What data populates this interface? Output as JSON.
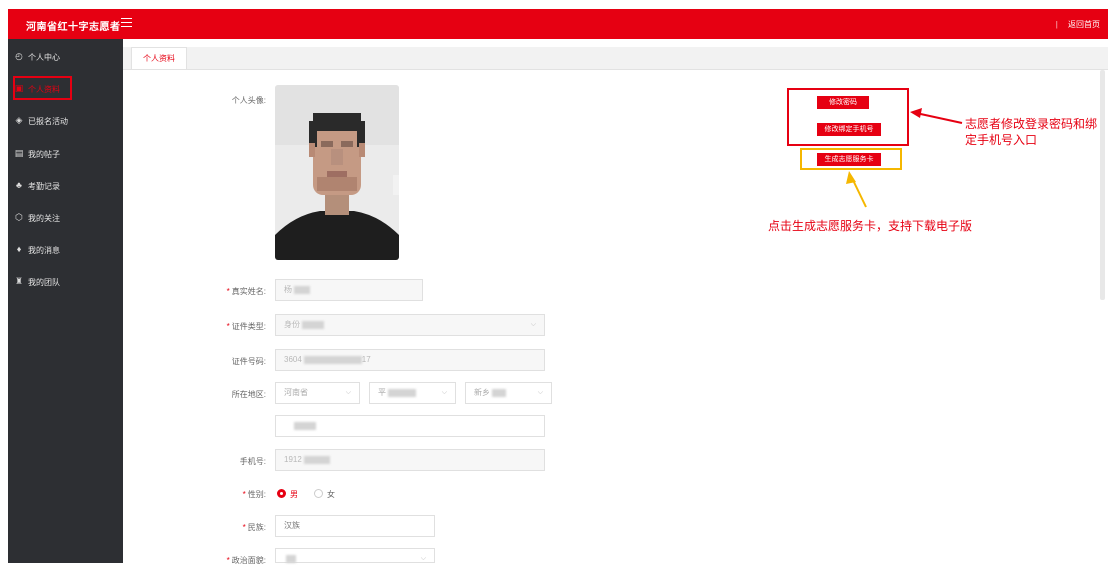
{
  "header": {
    "brand": "河南省红十字志愿者",
    "menu_icon": "hamburger-icon",
    "separator": "|",
    "home_link": "返回首页"
  },
  "sidebar": {
    "items": [
      {
        "label": "个人中心",
        "icon": "dashboard-icon",
        "glyph": "◴"
      },
      {
        "label": "个人资料",
        "icon": "user-icon",
        "glyph": "▣"
      },
      {
        "label": "已报名活动",
        "icon": "layers-icon",
        "glyph": "◈"
      },
      {
        "label": "我的帖子",
        "icon": "posts-icon",
        "glyph": "▤"
      },
      {
        "label": "考勤记录",
        "icon": "sitemap-icon",
        "glyph": "♣"
      },
      {
        "label": "我的关注",
        "icon": "cube-icon",
        "glyph": "⬡"
      },
      {
        "label": "我的消息",
        "icon": "bell-icon",
        "glyph": "♦"
      },
      {
        "label": "我的团队",
        "icon": "team-icon",
        "glyph": "♜"
      }
    ]
  },
  "tabs": [
    {
      "label": "个人资料"
    }
  ],
  "form": {
    "avatar_label": "个人头像:",
    "real_name_label": "真实姓名:",
    "real_name_value": "杨",
    "id_type_label": "证件类型:",
    "id_type_value": "身份",
    "id_number_label": "证件号码:",
    "id_number_prefix": "3604",
    "id_number_suffix": "17",
    "region_label": "所在地区:",
    "province": "河南省",
    "city": "平",
    "district": "新乡",
    "address_value": "",
    "phone_label": "手机号:",
    "phone_value": "1912",
    "gender_label": "性别:",
    "gender_male": "男",
    "gender_female": "女",
    "ethnicity_label": "民族:",
    "ethnicity_value": "汉族",
    "political_label": "政治面貌:"
  },
  "actions": {
    "change_password": "修改密码",
    "change_phone": "修改绑定手机号",
    "generate_card": "生成志愿服务卡"
  },
  "annotations": {
    "red_note": "志愿者修改登录密码和绑定手机号入口",
    "red_note_line1": "志愿者修改登录密码和绑",
    "red_note_line2": "定手机号入口",
    "yellow_note": "点击生成志愿服务卡，支持下载电子版"
  },
  "colors": {
    "brand_red": "#e60012",
    "sidebar_bg": "#2d2f33",
    "highlight_yellow": "#f5b700"
  }
}
